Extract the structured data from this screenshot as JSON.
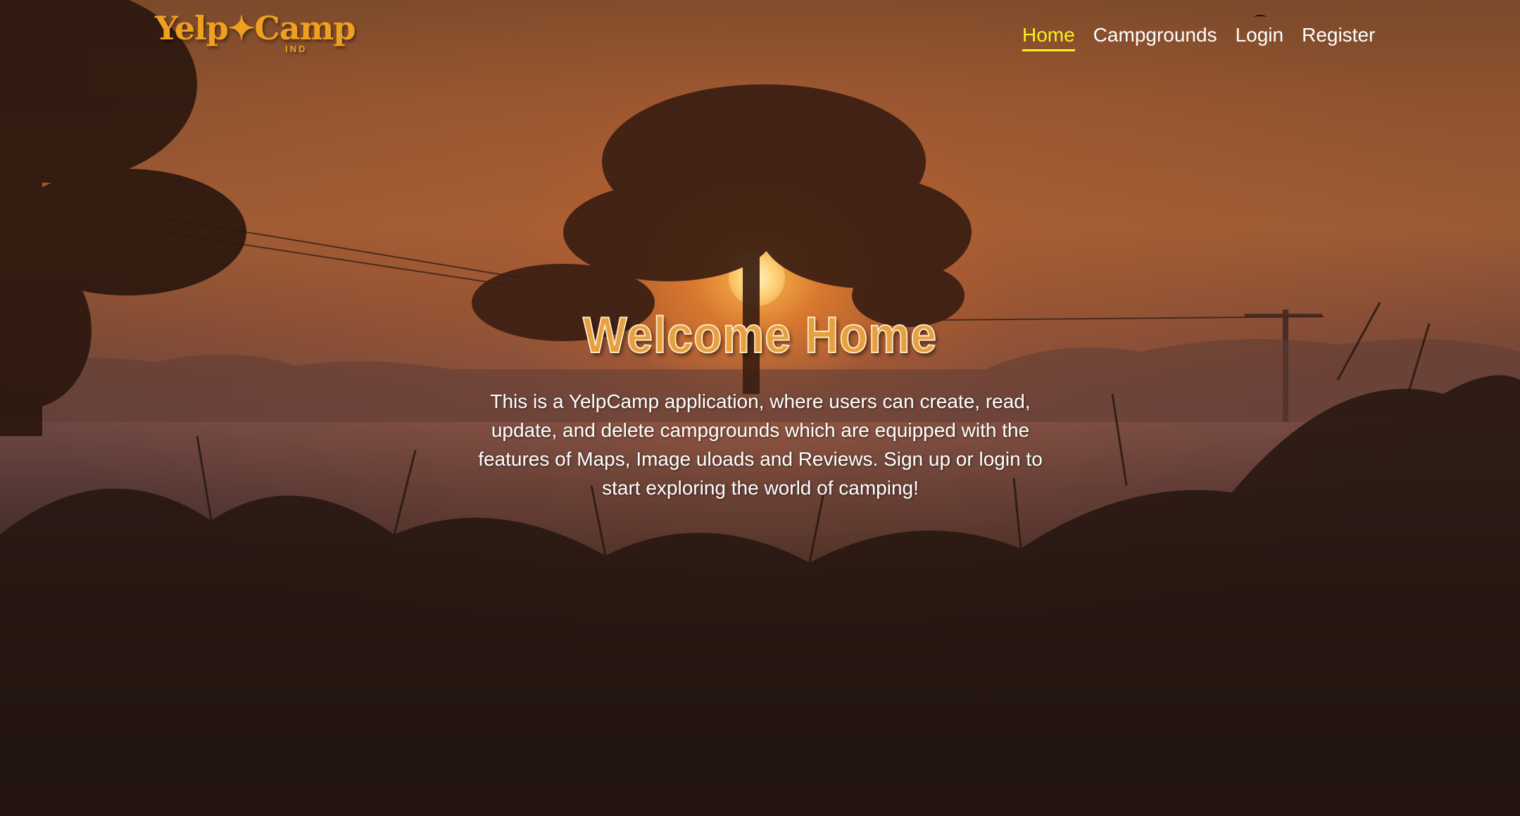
{
  "navbar": {
    "logo": {
      "main": "Yelp✦Camp",
      "sub": "IND"
    },
    "links": [
      {
        "label": "Home",
        "active": true
      },
      {
        "label": "Campgrounds",
        "active": false
      },
      {
        "label": "Login",
        "active": false
      },
      {
        "label": "Register",
        "active": false
      }
    ]
  },
  "hero": {
    "title": "Welcome Home",
    "description": "This is a YelpCamp application, where users can create, read, update, and delete campgrounds which are equipped with the features of Maps, Image uloads and Reviews. Sign up or login to start exploring the world of camping!"
  },
  "colors": {
    "logo": "#f0a020",
    "nav_active": "#ffee1a",
    "nav_text": "#ffffff",
    "title_fill": "#e6a040"
  },
  "background": {
    "subject": "sunset-tree-silhouette"
  }
}
